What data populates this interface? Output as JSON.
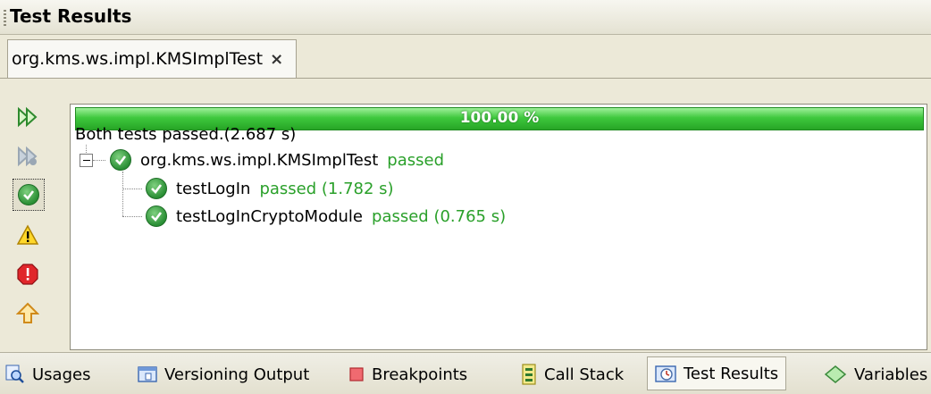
{
  "panel": {
    "title": "Test Results"
  },
  "tab": {
    "label": "org.kms.ws.impl.KMSImplTest",
    "close_symbol": "×"
  },
  "toolbar": {
    "items": [
      {
        "icon": "rerun-icon"
      },
      {
        "icon": "rerun-failed-icon"
      },
      {
        "icon": "show-passed-icon",
        "selected": true
      },
      {
        "icon": "show-warnings-icon"
      },
      {
        "icon": "show-errors-icon"
      },
      {
        "icon": "previous-failure-icon"
      }
    ]
  },
  "progress": {
    "label": "100.00 %",
    "fraction": 1.0
  },
  "summary": "Both tests passed.(2.687 s)",
  "tree": {
    "root": {
      "name": "org.kms.ws.impl.KMSImplTest",
      "status": "passed"
    },
    "children": [
      {
        "name": "testLogIn",
        "status": "passed (1.782 s)"
      },
      {
        "name": "testLogInCryptoModule",
        "status": "passed (0.765 s)"
      }
    ]
  },
  "bottom_tabs": [
    {
      "label": "Usages",
      "icon": "usages-icon"
    },
    {
      "label": "Versioning Output",
      "icon": "versioning-output-icon"
    },
    {
      "label": "Breakpoints",
      "icon": "breakpoints-icon"
    },
    {
      "label": "Call Stack",
      "icon": "call-stack-icon"
    },
    {
      "label": "Test Results",
      "icon": "test-results-icon",
      "active": true
    },
    {
      "label": "Variables",
      "icon": "variables-icon"
    }
  ],
  "colors": {
    "progress_green": "#3ec83d",
    "passed_text": "#2aa02a",
    "background": "#ece9d8"
  }
}
